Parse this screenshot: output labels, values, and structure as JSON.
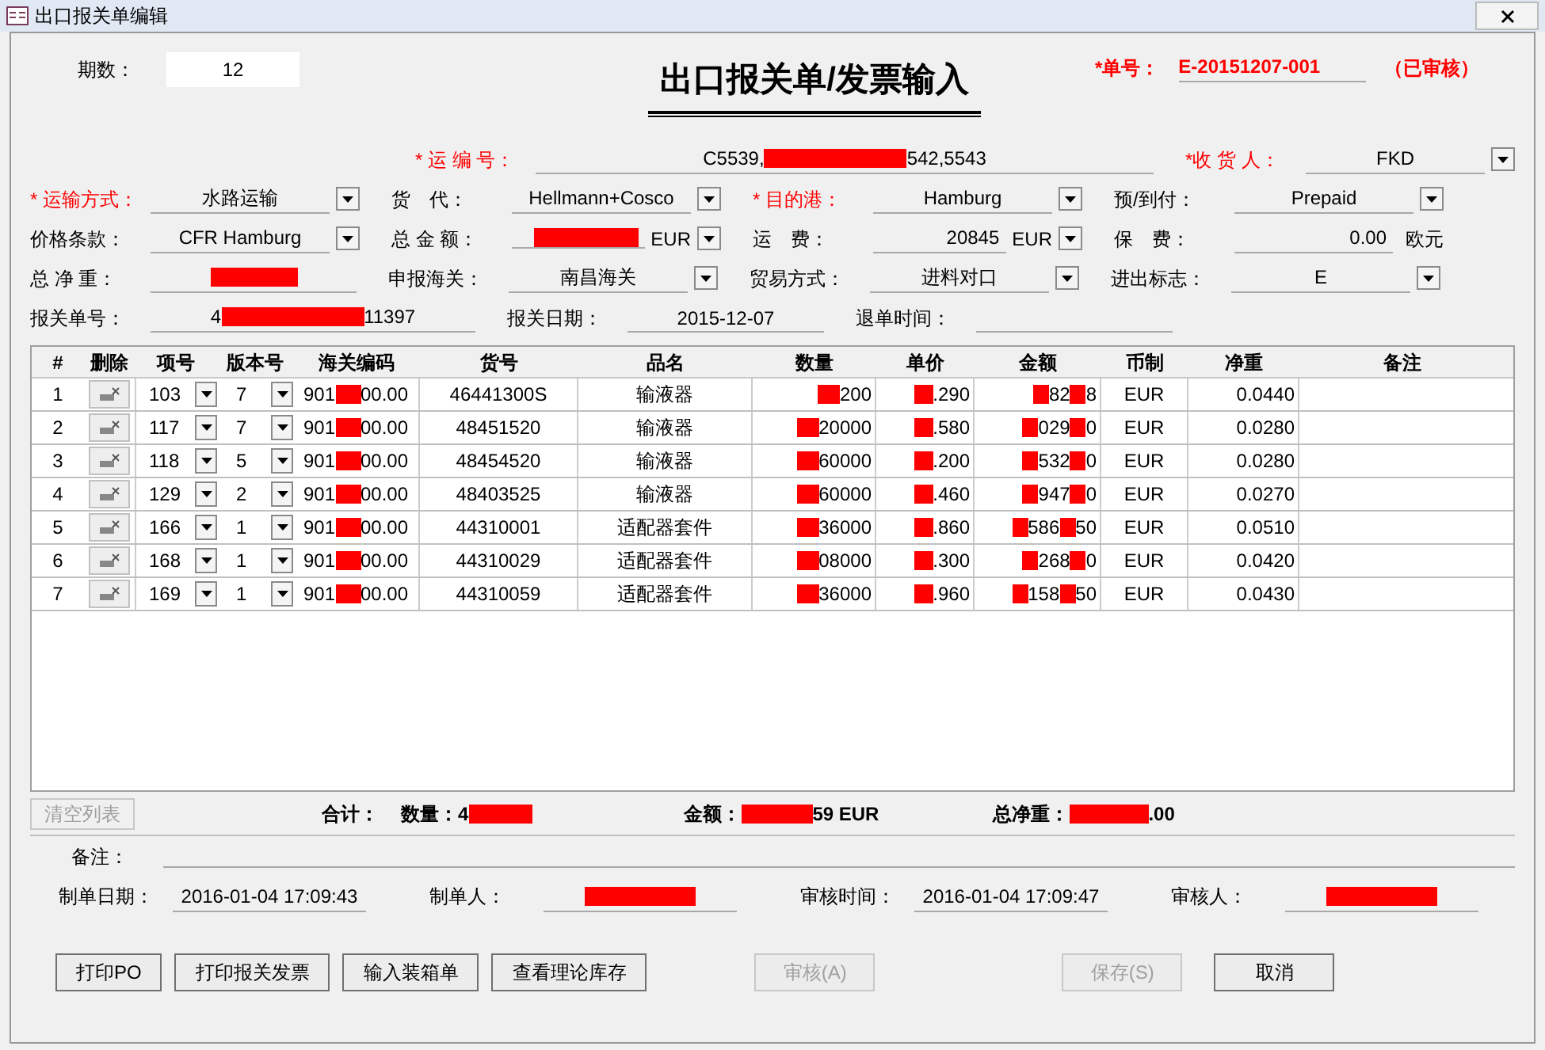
{
  "window": {
    "title": "出口报关单编辑"
  },
  "header": {
    "period_label": "期数：",
    "period_value": "12",
    "title": "出口报关单/发票输入",
    "number_label": "*单号：",
    "number_value": "E-20151207-001",
    "status": "（已审核）"
  },
  "form_rows": [
    [
      {
        "kind": "empty"
      },
      {
        "label": "* 运 编 号：",
        "required": true,
        "kind": "wide",
        "parts": [
          {
            "kind": "text",
            "text": "C5539,"
          },
          {
            "kind": "redacted"
          },
          {
            "kind": "text",
            "text": "542,5543"
          }
        ]
      },
      {
        "label": "*收 货 人：",
        "required": true,
        "kind": "dropdown",
        "value": "FKD"
      }
    ],
    [
      {
        "label": "* 运输方式：",
        "required": true,
        "kind": "dropdown",
        "value": "水路运输"
      },
      {
        "label": "货　代：",
        "required": false,
        "kind": "dropdown",
        "value": "Hellmann+Cosco"
      },
      {
        "label": "* 目的港：",
        "required": true,
        "kind": "dropdown",
        "value": "Hamburg"
      },
      {
        "label": "预/到付：",
        "required": false,
        "kind": "dropdown",
        "value": "Prepaid"
      }
    ],
    [
      {
        "label": "价格条款：",
        "required": false,
        "kind": "dropdown",
        "value": "CFR Hamburg"
      },
      {
        "label": "总 金 额：",
        "required": false,
        "kind": "currency",
        "parts": [
          {
            "kind": "redacted"
          }
        ],
        "unit": "EUR"
      },
      {
        "label": "运　费：",
        "required": false,
        "kind": "currency",
        "parts": [
          {
            "kind": "text",
            "text": "20845"
          }
        ],
        "unit": "EUR"
      },
      {
        "label": "保　费：",
        "required": false,
        "kind": "suffix",
        "value": "0.00",
        "unit": "欧元"
      }
    ],
    [
      {
        "label": "总 净 重：",
        "required": false,
        "kind": "redacted",
        "parts": [
          {
            "kind": "redacted"
          }
        ]
      },
      {
        "label": "申报海关：",
        "required": false,
        "kind": "dropdown",
        "value": "南昌海关"
      },
      {
        "label": "贸易方式：",
        "required": false,
        "kind": "dropdown",
        "value": "进料对口"
      },
      {
        "label": "进出标志：",
        "required": false,
        "kind": "dropdown",
        "value": "E"
      }
    ],
    [
      {
        "label": "报关单号：",
        "required": false,
        "kind": "long",
        "parts": [
          {
            "kind": "text",
            "text": "4"
          },
          {
            "kind": "redacted"
          },
          {
            "kind": "text",
            "text": "11397"
          }
        ]
      },
      {
        "label": "报关日期：",
        "required": false,
        "kind": "text",
        "value": "2015-12-07"
      },
      {
        "label": "退单时间：",
        "required": false,
        "kind": "text"
      }
    ]
  ],
  "table": {
    "columns": [
      "#",
      "删除",
      "项号",
      "版本号",
      "海关编码",
      "货号",
      "品名",
      "数量",
      "单价",
      "金额",
      "币制",
      "净重",
      "备注"
    ],
    "rows": [
      {
        "no": "1",
        "item": "103",
        "version": "7",
        "code": [
          {
            "kind": "text",
            "text": "901"
          },
          {
            "kind": "redacted"
          },
          {
            "kind": "text",
            "text": "00.00"
          }
        ],
        "part": "46441300S",
        "name": "输液器",
        "qty": [
          {
            "kind": "redacted"
          },
          {
            "kind": "text",
            "text": "200"
          }
        ],
        "price": [
          {
            "kind": "redacted"
          },
          {
            "kind": "text",
            "text": ".290"
          }
        ],
        "amount": [
          {
            "kind": "redacted"
          },
          {
            "kind": "text",
            "text": "82"
          },
          {
            "kind": "redacted"
          },
          {
            "kind": "text",
            "text": "8"
          }
        ],
        "currency": "EUR",
        "weight": "0.0440"
      },
      {
        "no": "2",
        "item": "117",
        "version": "7",
        "code": [
          {
            "kind": "text",
            "text": "901"
          },
          {
            "kind": "redacted"
          },
          {
            "kind": "text",
            "text": "00.00"
          }
        ],
        "part": "48451520",
        "name": "输液器",
        "qty": [
          {
            "kind": "redacted"
          },
          {
            "kind": "text",
            "text": "20000"
          }
        ],
        "price": [
          {
            "kind": "redacted"
          },
          {
            "kind": "text",
            "text": ".580"
          }
        ],
        "amount": [
          {
            "kind": "redacted"
          },
          {
            "kind": "text",
            "text": "029"
          },
          {
            "kind": "redacted"
          },
          {
            "kind": "text",
            "text": "0"
          }
        ],
        "currency": "EUR",
        "weight": "0.0280"
      },
      {
        "no": "3",
        "item": "118",
        "version": "5",
        "code": [
          {
            "kind": "text",
            "text": "901"
          },
          {
            "kind": "redacted"
          },
          {
            "kind": "text",
            "text": "00.00"
          }
        ],
        "part": "48454520",
        "name": "输液器",
        "qty": [
          {
            "kind": "redacted"
          },
          {
            "kind": "text",
            "text": "60000"
          }
        ],
        "price": [
          {
            "kind": "redacted"
          },
          {
            "kind": "text",
            "text": ".200"
          }
        ],
        "amount": [
          {
            "kind": "redacted"
          },
          {
            "kind": "text",
            "text": "532"
          },
          {
            "kind": "redacted"
          },
          {
            "kind": "text",
            "text": "0"
          }
        ],
        "currency": "EUR",
        "weight": "0.0280"
      },
      {
        "no": "4",
        "item": "129",
        "version": "2",
        "code": [
          {
            "kind": "text",
            "text": "901"
          },
          {
            "kind": "redacted"
          },
          {
            "kind": "text",
            "text": "00.00"
          }
        ],
        "part": "48403525",
        "name": "输液器",
        "qty": [
          {
            "kind": "redacted"
          },
          {
            "kind": "text",
            "text": "60000"
          }
        ],
        "price": [
          {
            "kind": "redacted"
          },
          {
            "kind": "text",
            "text": ".460"
          }
        ],
        "amount": [
          {
            "kind": "redacted"
          },
          {
            "kind": "text",
            "text": "947"
          },
          {
            "kind": "redacted"
          },
          {
            "kind": "text",
            "text": "0"
          }
        ],
        "currency": "EUR",
        "weight": "0.0270"
      },
      {
        "no": "5",
        "item": "166",
        "version": "1",
        "code": [
          {
            "kind": "text",
            "text": "901"
          },
          {
            "kind": "redacted"
          },
          {
            "kind": "text",
            "text": "00.00"
          }
        ],
        "part": "44310001",
        "name": "适配器套件",
        "qty": [
          {
            "kind": "redacted"
          },
          {
            "kind": "text",
            "text": "36000"
          }
        ],
        "price": [
          {
            "kind": "redacted"
          },
          {
            "kind": "text",
            "text": ".860"
          }
        ],
        "amount": [
          {
            "kind": "redacted"
          },
          {
            "kind": "text",
            "text": "586"
          },
          {
            "kind": "redacted"
          },
          {
            "kind": "text",
            "text": "50"
          }
        ],
        "currency": "EUR",
        "weight": "0.0510"
      },
      {
        "no": "6",
        "item": "168",
        "version": "1",
        "code": [
          {
            "kind": "text",
            "text": "901"
          },
          {
            "kind": "redacted"
          },
          {
            "kind": "text",
            "text": "00.00"
          }
        ],
        "part": "44310029",
        "name": "适配器套件",
        "qty": [
          {
            "kind": "redacted"
          },
          {
            "kind": "text",
            "text": "08000"
          }
        ],
        "price": [
          {
            "kind": "redacted"
          },
          {
            "kind": "text",
            "text": ".300"
          }
        ],
        "amount": [
          {
            "kind": "redacted"
          },
          {
            "kind": "text",
            "text": "268"
          },
          {
            "kind": "redacted"
          },
          {
            "kind": "text",
            "text": "0"
          }
        ],
        "currency": "EUR",
        "weight": "0.0420"
      },
      {
        "no": "7",
        "item": "169",
        "version": "1",
        "code": [
          {
            "kind": "text",
            "text": "901"
          },
          {
            "kind": "redacted"
          },
          {
            "kind": "text",
            "text": "00.00"
          }
        ],
        "part": "44310059",
        "name": "适配器套件",
        "qty": [
          {
            "kind": "redacted"
          },
          {
            "kind": "text",
            "text": "36000"
          }
        ],
        "price": [
          {
            "kind": "redacted"
          },
          {
            "kind": "text",
            "text": ".960"
          }
        ],
        "amount": [
          {
            "kind": "redacted"
          },
          {
            "kind": "text",
            "text": "158"
          },
          {
            "kind": "redacted"
          },
          {
            "kind": "text",
            "text": "50"
          }
        ],
        "currency": "EUR",
        "weight": "0.0430"
      }
    ]
  },
  "totals": {
    "clear_button": {
      "label": "清空列表",
      "disabled": true
    },
    "total_label": "合计：",
    "qty_label": "数量：",
    "qty": [
      {
        "kind": "text",
        "text": "4"
      },
      {
        "kind": "redacted"
      }
    ],
    "amount_label": "金额：",
    "amount": [
      {
        "kind": "redacted"
      },
      {
        "kind": "text",
        "text": "59 EUR"
      }
    ],
    "weight_label": "总净重：",
    "weight": [
      {
        "kind": "redacted"
      },
      {
        "kind": "text",
        "text": ".00"
      }
    ]
  },
  "remarks": {
    "label": "备注："
  },
  "audit": [
    {
      "label": "制单日期：",
      "parts": [
        {
          "kind": "text",
          "text": "2016-01-04 17:09:43"
        }
      ]
    },
    {
      "label": "制单人：",
      "parts": [
        {
          "kind": "redacted"
        }
      ]
    },
    {
      "label": "审核时间：",
      "parts": [
        {
          "kind": "text",
          "text": "2016-01-04 17:09:47"
        }
      ]
    },
    {
      "label": "审核人：",
      "parts": [
        {
          "kind": "redacted"
        }
      ]
    }
  ],
  "buttons": [
    {
      "label": "打印PO",
      "disabled": false
    },
    {
      "label": "打印报关发票",
      "disabled": false
    },
    {
      "label": "输入装箱单",
      "disabled": false
    },
    {
      "label": "查看理论库存",
      "disabled": false
    },
    {
      "label": "审核(A)",
      "disabled": true
    },
    {
      "label": "保存(S)",
      "disabled": true
    },
    {
      "label": "取消",
      "disabled": false
    }
  ]
}
